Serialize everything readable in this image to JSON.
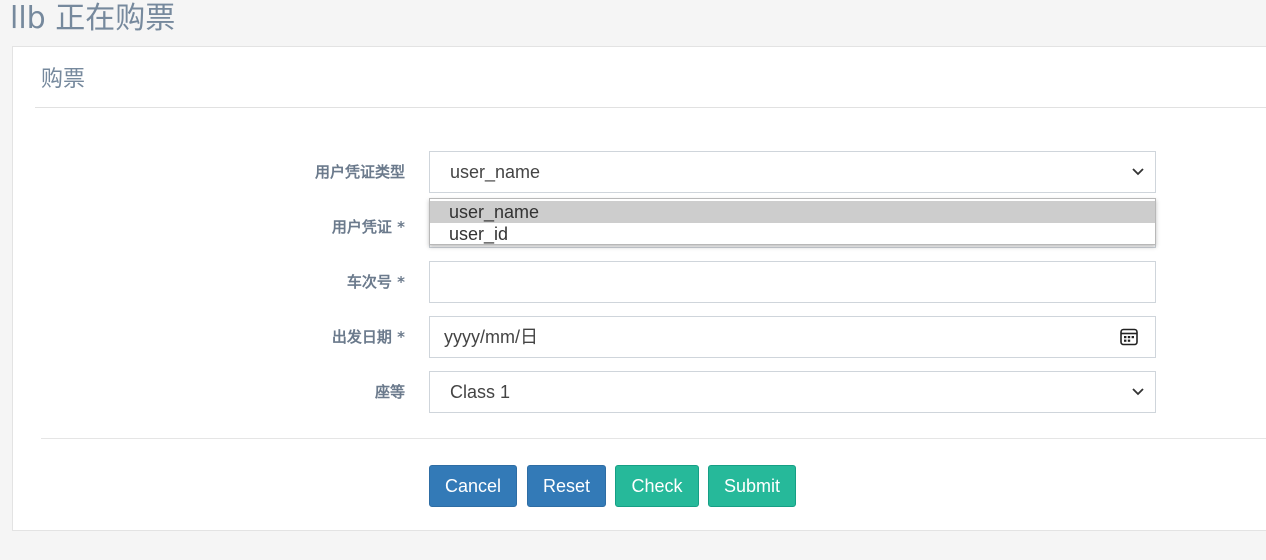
{
  "page": {
    "title": "llb 正在购票"
  },
  "panel": {
    "title": "购票"
  },
  "form": {
    "credential_type": {
      "label": "用户凭证类型",
      "value": "user_name",
      "options": [
        "user_name",
        "user_id"
      ],
      "highlighted_option": "user_name"
    },
    "credential": {
      "label": "用户凭证 *",
      "value": ""
    },
    "train_number": {
      "label": "车次号 *",
      "value": ""
    },
    "departure_date": {
      "label": "出发日期 *",
      "placeholder": "yyyy/mm/日",
      "icon": "calendar-icon"
    },
    "seat_class": {
      "label": "座等",
      "value": "Class 1"
    }
  },
  "buttons": {
    "cancel": "Cancel",
    "reset": "Reset",
    "check": "Check",
    "submit": "Submit"
  },
  "colors": {
    "primary": "#337ab7",
    "success": "#26b99a",
    "title_text": "#76899d",
    "label_text": "#6b7a8c"
  }
}
